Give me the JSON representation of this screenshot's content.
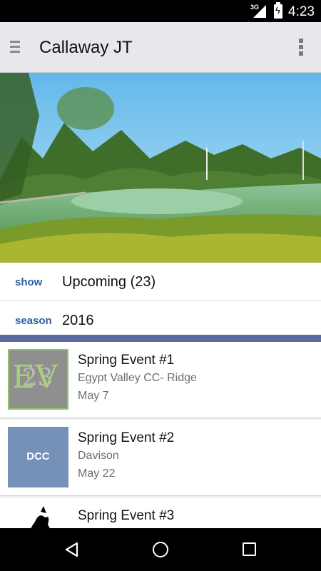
{
  "status_bar": {
    "network": "3G",
    "time": "4:23",
    "icons": [
      "signal-icon",
      "battery-charging-icon"
    ]
  },
  "app_bar": {
    "title": "Callaway JT",
    "menu_icon": "menu-icon",
    "overflow_icon": "more-vert-icon"
  },
  "hero": {
    "description_icon": "golf-course-photo"
  },
  "filters": [
    {
      "key": "show",
      "value": "Upcoming (23)"
    },
    {
      "key": "season",
      "value": "2016"
    }
  ],
  "colors": {
    "accent": "#5a6a9e",
    "filter_label": "#2c5f9e",
    "dcc_thumb": "#7591b8",
    "ev_border": "#8ac46a"
  },
  "events": [
    {
      "name": "Spring Event #1",
      "venue": "Egypt Valley CC- Ridge",
      "date": "May 7",
      "thumb_text": "EV",
      "thumb_text2": "23"
    },
    {
      "name": "Spring Event #2",
      "venue": "Davison",
      "date": "May 22",
      "thumb_text": "DCC"
    },
    {
      "name": "Spring Event #3",
      "venue": "",
      "date": ""
    }
  ],
  "nav_bar": {
    "icons": [
      "back-icon",
      "home-icon",
      "recents-icon"
    ]
  }
}
